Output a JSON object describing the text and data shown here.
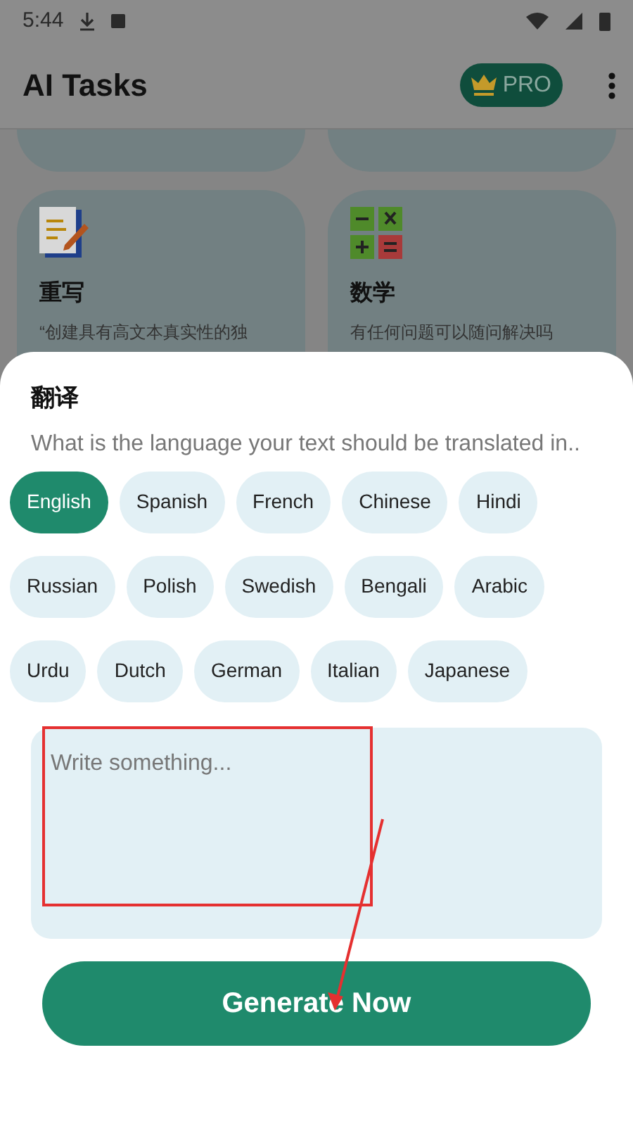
{
  "status_bar": {
    "time": "5:44"
  },
  "app_bar": {
    "title": "AI Tasks",
    "pro_badge": "PRO"
  },
  "cards": [
    {
      "title": "重写",
      "description": "“创建具有高文本真实性的独",
      "kind": "rewrite"
    },
    {
      "title": "数学",
      "description": "有任何问题可以随问解决吗",
      "kind": "math"
    }
  ],
  "sheet": {
    "title": "翻译",
    "prompt": "What is the language your text should be translated in..",
    "language_rows": [
      [
        {
          "label": "English",
          "selected": true
        },
        {
          "label": "Spanish",
          "selected": false
        },
        {
          "label": "French",
          "selected": false
        },
        {
          "label": "Chinese",
          "selected": false
        },
        {
          "label": "Hindi",
          "selected": false
        }
      ],
      [
        {
          "label": "Russian",
          "selected": false
        },
        {
          "label": "Polish",
          "selected": false
        },
        {
          "label": "Swedish",
          "selected": false
        },
        {
          "label": "Bengali",
          "selected": false
        },
        {
          "label": "Arabic",
          "selected": false
        }
      ],
      [
        {
          "label": "Urdu",
          "selected": false
        },
        {
          "label": "Dutch",
          "selected": false
        },
        {
          "label": "German",
          "selected": false
        },
        {
          "label": "Italian",
          "selected": false
        },
        {
          "label": "Japanese",
          "selected": false
        }
      ]
    ],
    "input": {
      "placeholder": "Write something..."
    },
    "generate_button": "Generate Now"
  }
}
